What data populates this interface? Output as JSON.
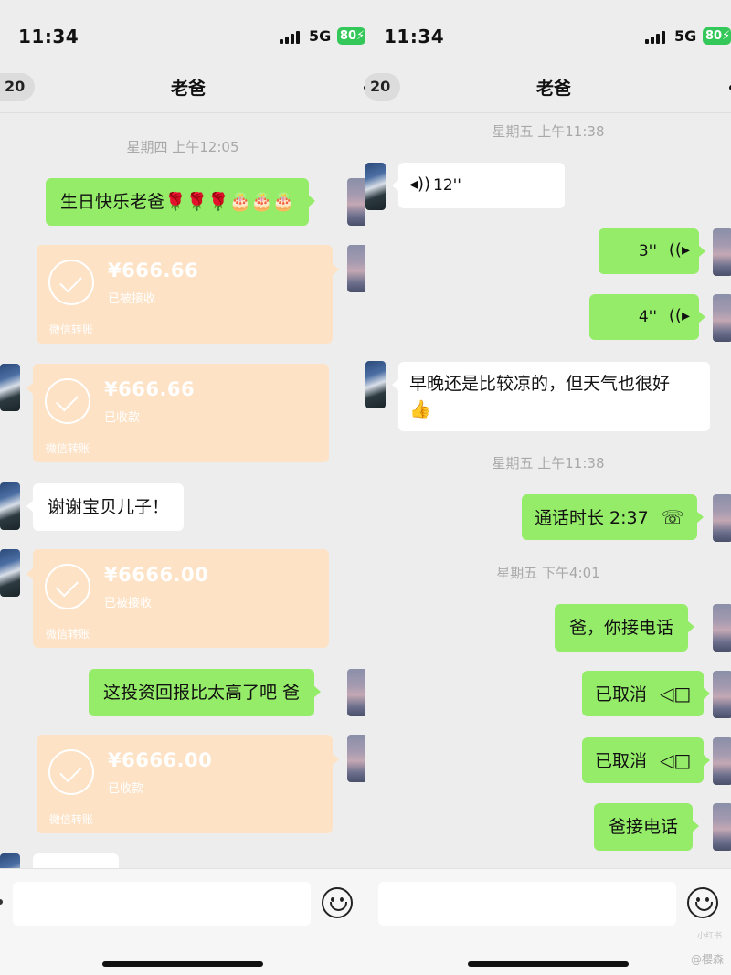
{
  "colors": {
    "green_bubble": "#95ec69",
    "transfer_bg": "#fde2c6",
    "battery": "#34c759"
  },
  "left": {
    "status": {
      "time": "11:34",
      "network": "5G",
      "battery": "80"
    },
    "nav": {
      "back_count": "20",
      "title": "老爸"
    },
    "timestamp": "星期四 上午12:05",
    "msg_birthday": "生日快乐老爸🌹🌹🌹🎂🎂🎂",
    "transfer1": {
      "amount": "¥666.66",
      "status": "已被接收",
      "footer": "微信转账"
    },
    "transfer2": {
      "amount": "¥666.66",
      "status": "已收款",
      "footer": "微信转账"
    },
    "msg_thanks": "谢谢宝贝儿子！",
    "transfer3": {
      "amount": "¥6666.00",
      "status": "已被接收",
      "footer": "微信转账"
    },
    "msg_return": "这投资回报比太高了吧 爸",
    "transfer4": {
      "amount": "¥6666.00",
      "status": "已收款",
      "footer": "微信转账"
    }
  },
  "right": {
    "status": {
      "time": "11:34",
      "network": "5G",
      "battery": "80"
    },
    "nav": {
      "back_count": "20",
      "title": "老爸"
    },
    "timestamp1": "星期五 上午11:38",
    "voice_in": "12''",
    "voice_out1": "3''",
    "voice_out2": "4''",
    "msg_weather": "早晚还是比较凉的，但天气也很好",
    "msg_weather_emoji": "👍",
    "timestamp2": "星期五 上午11:38",
    "call_duration": "通话时长 2:37",
    "timestamp3": "星期五 下午4:01",
    "msg_answer": "爸，你接电话",
    "cancelled1": "已取消",
    "cancelled2": "已取消",
    "msg_answer2": "爸接电话",
    "watermark": "@櫻森",
    "watermark_small": "小红书"
  },
  "icons": {
    "voice": "voice-wave-icon",
    "call": "phone-hangup-icon",
    "video": "video-call-icon",
    "emoji": "emoji-icon"
  }
}
